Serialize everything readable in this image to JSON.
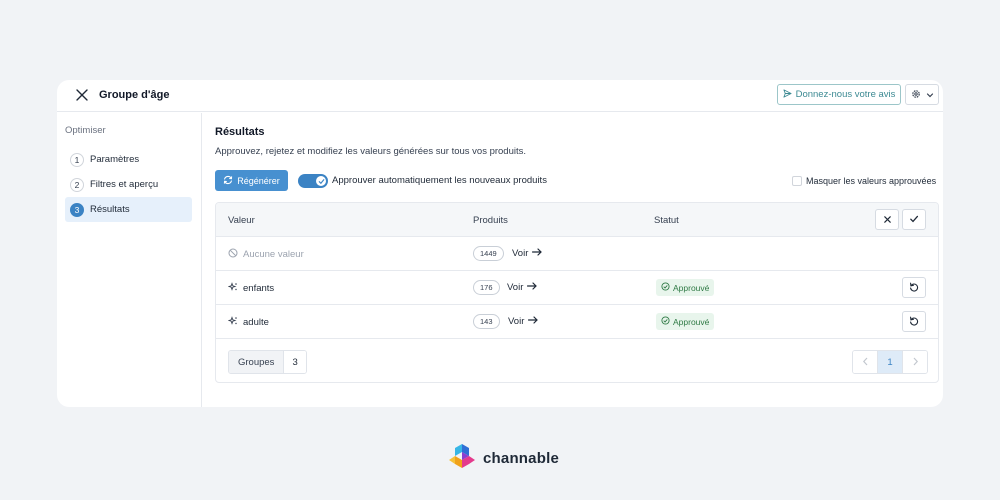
{
  "window": {
    "title": "Groupe d'âge",
    "feedback_label": "Donnez-nous votre avis"
  },
  "sidebar": {
    "heading": "Optimiser",
    "steps": [
      {
        "num": "1",
        "label": "Paramètres",
        "active": false
      },
      {
        "num": "2",
        "label": "Filtres et aperçu",
        "active": false
      },
      {
        "num": "3",
        "label": "Résultats",
        "active": true
      }
    ]
  },
  "main": {
    "title": "Résultats",
    "description": "Approuvez, rejetez et modifiez les valeurs générées sur tous vos produits.",
    "regenerate_label": "Régénérer",
    "auto_approve_label": "Approuver automatiquement les nouveaux produits",
    "auto_approve_on": true,
    "hide_approved_label": "Masquer les valeurs approuvées",
    "hide_approved_checked": false
  },
  "table": {
    "headers": {
      "value": "Valeur",
      "products": "Produits",
      "status": "Statut"
    },
    "rows": [
      {
        "value": "Aucune valeur",
        "count": "1449",
        "link": "Voir",
        "status": "",
        "icon": "no-value-icon"
      },
      {
        "value": "enfants",
        "count": "176",
        "link": "Voir",
        "status": "Approuvé",
        "icon": "sparkle-icon"
      },
      {
        "value": "adulte",
        "count": "143",
        "link": "Voir",
        "status": "Approuvé",
        "icon": "sparkle-icon"
      }
    ],
    "groups_label": "Groupes",
    "groups_count": "3",
    "current_page": "1"
  },
  "brand": {
    "name": "channable"
  },
  "colors": {
    "accent": "#3b83c4",
    "approved": "#2f7a45",
    "approved_bg": "#e8f5ec",
    "feedback": "#3d8a93"
  }
}
